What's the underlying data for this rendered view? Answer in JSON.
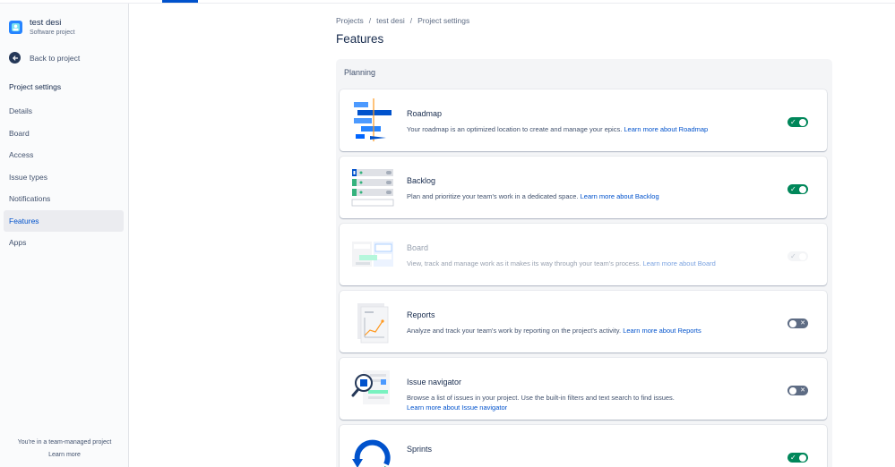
{
  "sidebar": {
    "project_name": "test desi",
    "project_type": "Software project",
    "back_label": "Back to project",
    "section_label": "Project settings",
    "items": [
      {
        "label": "Details"
      },
      {
        "label": "Board"
      },
      {
        "label": "Access"
      },
      {
        "label": "Issue types"
      },
      {
        "label": "Notifications"
      },
      {
        "label": "Features"
      },
      {
        "label": "Apps"
      }
    ],
    "active_item": "Features",
    "footer_text": "You're in a team-managed project",
    "footer_link": "Learn more"
  },
  "breadcrumb": [
    "Projects",
    "test desi",
    "Project settings"
  ],
  "page_title": "Features",
  "planning": {
    "title": "Planning",
    "features": [
      {
        "title": "Roadmap",
        "desc": "Your roadmap is an optimized location to create and manage your epics.",
        "link": "Learn more about Roadmap",
        "state": "on",
        "icon": "roadmap-illustration"
      },
      {
        "title": "Backlog",
        "desc": "Plan and prioritize your team's work in a dedicated space.",
        "link": "Learn more about Backlog",
        "state": "on",
        "icon": "backlog-illustration"
      },
      {
        "title": "Board",
        "desc": "View, track and manage work as it makes its way through your team's process.",
        "link": "Learn more about Board",
        "state": "disabled",
        "icon": "board-illustration"
      },
      {
        "title": "Reports",
        "desc": "Analyze and track your team's work by reporting on the project's activity.",
        "link": "Learn more about Reports",
        "state": "off",
        "icon": "reports-illustration"
      },
      {
        "title": "Issue navigator",
        "desc": "Browse a list of issues in your project. Use the built-in filters and text search to find issues.",
        "link": "Learn more about Issue navigator",
        "state": "off",
        "icon": "issue-navigator-illustration"
      },
      {
        "title": "Sprints",
        "desc": "",
        "link": "",
        "state": "on",
        "icon": "sprints-illustration"
      }
    ]
  },
  "colors": {
    "accent": "#0052cc",
    "toggle_on": "#00875a",
    "toggle_off": "#5e6c84"
  }
}
